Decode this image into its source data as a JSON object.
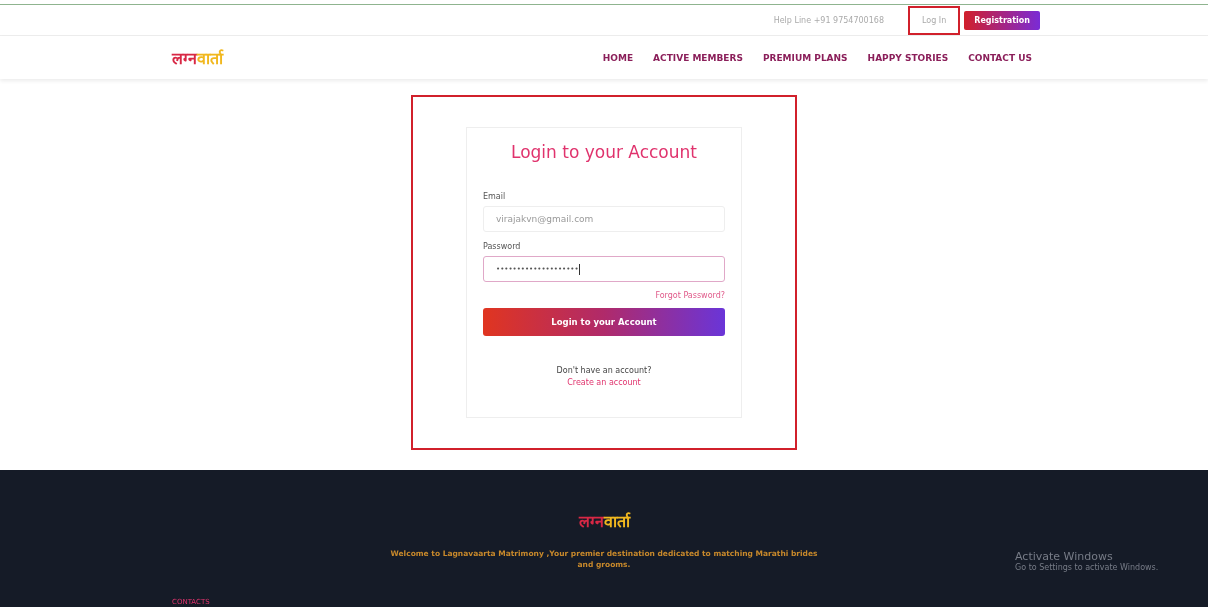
{
  "top_bar": {
    "helpline": "Help Line +91 9754700168",
    "login_link": {
      "label": "Log In",
      "highlighted": true
    },
    "register_button": "Registration"
  },
  "logo": {
    "part_1": "लग्न",
    "part_2": "वार्ता"
  },
  "nav": [
    {
      "label": "HOME"
    },
    {
      "label": "ACTIVE MEMBERS"
    },
    {
      "label": "PREMIUM PLANS"
    },
    {
      "label": "HAPPY STORIES"
    },
    {
      "label": "CONTACT US"
    }
  ],
  "login_form": {
    "highlighted": true,
    "title": "Login to your Account",
    "email": {
      "label": "Email",
      "placeholder": "virajakvn@gmail.com"
    },
    "password": {
      "label": "Password",
      "value": "••••••••••••••••••••",
      "focused": true
    },
    "forgot": "Forgot Password?",
    "submit": "Login to your Account",
    "signup_prompt": "Don't have an account?",
    "signup_link": "Create an account"
  },
  "footer": {
    "logo": {
      "part_1": "लग्न",
      "part_2": "वार्ता"
    },
    "welcome": "Welcome to Lagnavaarta Matrimony ,Your premier destination dedicated to matching Marathi brides and grooms.",
    "contacts_heading": "CONTACTS"
  },
  "os_notice": {
    "title": "Activate Windows",
    "text": "Go to Settings to activate Windows."
  }
}
